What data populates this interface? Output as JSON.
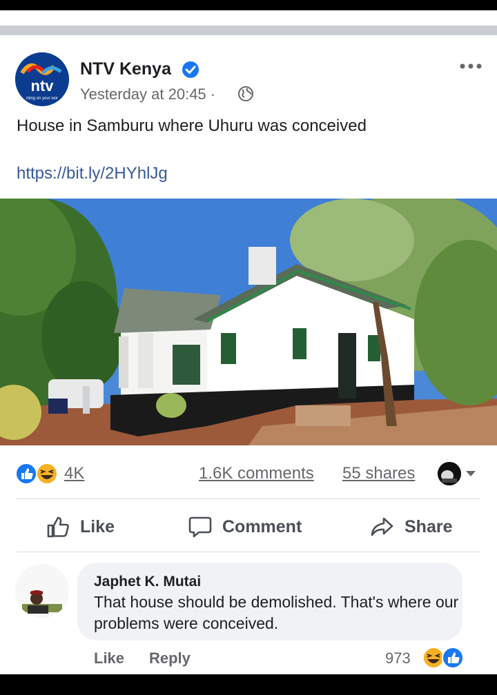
{
  "post": {
    "page_name": "NTV Kenya",
    "timestamp": "Yesterday at 20:45 ·",
    "text": "House in Samburu where Uhuru was conceived",
    "link": "https://bit.ly/2HYhlJg",
    "logo_text": "ntv",
    "logo_tagline": "ming on your wor"
  },
  "stats": {
    "reactions_count": "4K",
    "comments_count": "1.6K comments",
    "shares_count": "55 shares"
  },
  "actions": {
    "like": "Like",
    "comment": "Comment",
    "share": "Share"
  },
  "comment": {
    "author": "Japhet K. Mutai",
    "text": "That house should be demolished. That's where our problems were conceived.",
    "like": "Like",
    "reply": "Reply",
    "reaction_count": "973"
  },
  "colors": {
    "link": "#385898",
    "like_blue": "#1877f2",
    "haha_yellow": "#f7b125",
    "muted": "#65676b"
  },
  "icons": [
    "verified-icon",
    "globe-icon",
    "more-icon",
    "like-reaction-icon",
    "haha-reaction-icon",
    "thumbs-up-icon",
    "comment-icon",
    "share-icon",
    "caret-down-icon"
  ]
}
